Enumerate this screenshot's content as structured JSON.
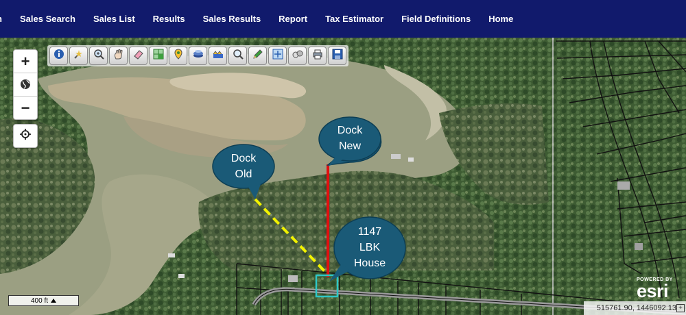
{
  "nav": {
    "items": [
      "Search",
      "Sales Search",
      "Sales List",
      "Results",
      "Sales Results",
      "Report",
      "Tax Estimator",
      "Field Definitions",
      "Home"
    ]
  },
  "map": {
    "zoom_in_symbol": "+",
    "zoom_out_symbol": "−",
    "toolbar_icons": [
      "info-icon",
      "identify-icon",
      "zoom-box-icon",
      "pan-hand-icon",
      "erase-icon",
      "select-parcel-icon",
      "add-point-icon",
      "layers-icon",
      "neighborhood-icon",
      "search-magnifier-icon",
      "draw-pencil-icon",
      "measure-icon",
      "buffer-icon",
      "print-icon",
      "save-icon"
    ],
    "callouts": {
      "dock_new": "Dock\nNew",
      "dock_old": "Dock\nOld",
      "house": "1147\nLBK\nHouse"
    },
    "scale_label": "400 ft",
    "coordinates": "515761.90, 1446092.13",
    "esri_powered": "POWERED BY",
    "esri_logo": "esri",
    "colors": {
      "nav_bg": "#111a6c",
      "callout_fill": "#1a5a77",
      "dock_new_line": "#e01010",
      "dock_old_line": "#f2f200",
      "house_box": "#2ec7c7"
    }
  }
}
